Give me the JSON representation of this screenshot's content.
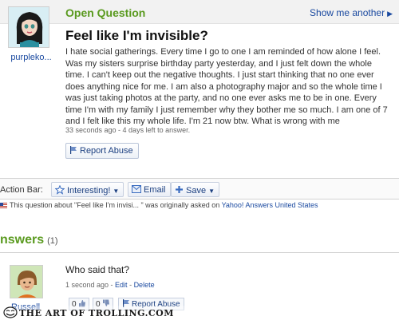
{
  "question": {
    "status": "Open Question",
    "show_another": "Show me another",
    "asker_name": "purpleko...",
    "title": "Feel like I'm invisible?",
    "body": "I hate social gatherings. Every time I go to one I am reminded of how alone I feel. Was my sisters surprise birthday party yesterday, and I just felt down the whole time. I can't keep out the negative thoughts. I just start thinking that no one ever does anything nice for me. I am also a photography major and so the whole time I was just taking photos at the party, and no one ever asks me to be in one. Every time I'm with my family I just remember why they bother me so much. I am one of 7 and I felt like this my whole life. I'm 21 now btw. What is wrong with me",
    "meta": "33 seconds ago - 4 days left to answer.",
    "report_label": "Report Abuse"
  },
  "action_bar": {
    "label": "Action Bar:",
    "interesting_label": "Interesting!",
    "email_label": "Email",
    "save_label": "Save"
  },
  "origin": {
    "prefix": "This question about \"Feel like I'm invisi... \" was originally asked on ",
    "site_link": "Yahoo! Answers United States"
  },
  "answers": {
    "heading": "nswers",
    "count": "(1)",
    "items": [
      {
        "name": "Russell",
        "text": "Who said that?",
        "time": "1 second ago",
        "edit_label": "Edit",
        "delete_label": "Delete",
        "thumbs_up_count": "0",
        "thumbs_down_count": "0",
        "report_label": "Report Abuse"
      }
    ]
  },
  "watermark": "THE ART OF TROLLING.COM",
  "colors": {
    "status_green": "#5a9a1f",
    "link_blue": "#1b4aa0",
    "button_border": "#b9c4d8"
  },
  "icons": {
    "flag": "flag-icon",
    "star": "star-icon",
    "email": "envelope-icon",
    "save": "plus-icon",
    "thumbs_up": "thumbs-up-icon",
    "thumbs_down": "thumbs-down-icon"
  }
}
